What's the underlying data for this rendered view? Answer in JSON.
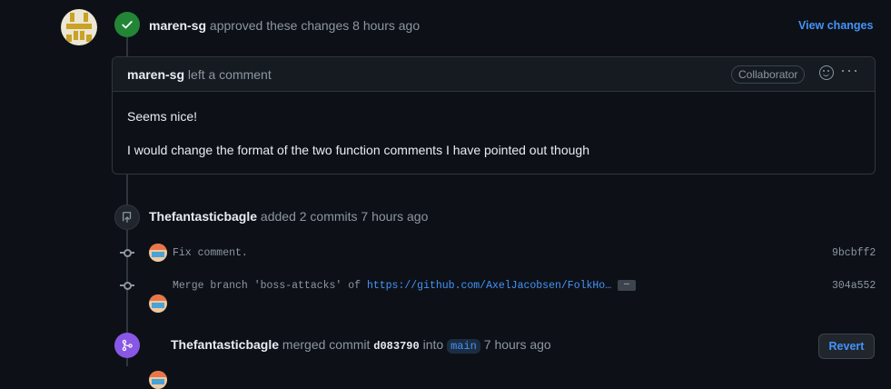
{
  "review": {
    "author": "maren-sg",
    "action": "approved these changes",
    "time": "8 hours ago",
    "view_changes": "View changes"
  },
  "comment": {
    "author": "maren-sg",
    "action": "left a comment",
    "role_badge": "Collaborator",
    "body_line1": "Seems nice!",
    "body_line2": "I would change the format of the two function comments I have pointed out though"
  },
  "commits_event": {
    "author": "Thefantasticbagle",
    "action": "added 2 commits",
    "time": "7 hours ago",
    "commits": [
      {
        "message": "Fix comment.",
        "sha": "9bcbff2"
      },
      {
        "message_prefix": "Merge branch 'boss-attacks' of",
        "message_link": "https://github.com/AxelJacobsen/FolkHo…",
        "sha": "304a552"
      }
    ]
  },
  "merge_event": {
    "author": "Thefantasticbagle",
    "action": "merged commit",
    "sha": "d083790",
    "into_word": "into",
    "branch": "main",
    "time": "7 hours ago",
    "revert": "Revert"
  },
  "icons": {
    "approve": "check-icon",
    "commit_push": "repo-push-icon",
    "merge": "git-merge-icon",
    "reaction": "smiley-icon",
    "more": "kebab-horizontal-icon"
  },
  "colors": {
    "background": "#0d1117",
    "approved_green": "#238636",
    "merged_purple": "#8957e5",
    "link_blue": "#4493f8"
  }
}
